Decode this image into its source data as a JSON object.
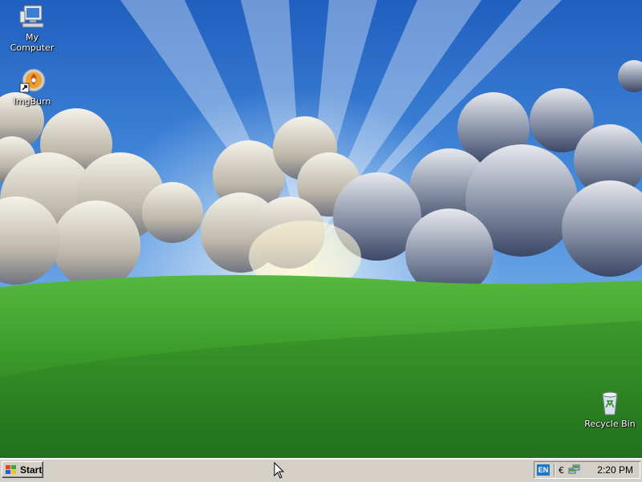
{
  "desktop": {
    "wallpaper": {
      "sky_top": "#1f5fc0",
      "sky_horizon": "#9fc7ef",
      "grass_light": "#4fb63a",
      "grass_dark": "#1f6e1d"
    },
    "icons": [
      {
        "label": "My Computer",
        "icon": "my-computer-icon"
      },
      {
        "label": "ImgBurn",
        "icon": "imgburn-icon"
      },
      {
        "label": "Recycle Bin",
        "icon": "recycle-bin-icon"
      }
    ]
  },
  "taskbar": {
    "start_label": "Start",
    "tray": {
      "language": "EN",
      "small_glyph": "€",
      "network_icon": "network-icon",
      "clock": "2:20 PM"
    }
  },
  "colors": {
    "taskbar_bg": "#d4d0c8",
    "lang_badge": "#1c78c9"
  }
}
